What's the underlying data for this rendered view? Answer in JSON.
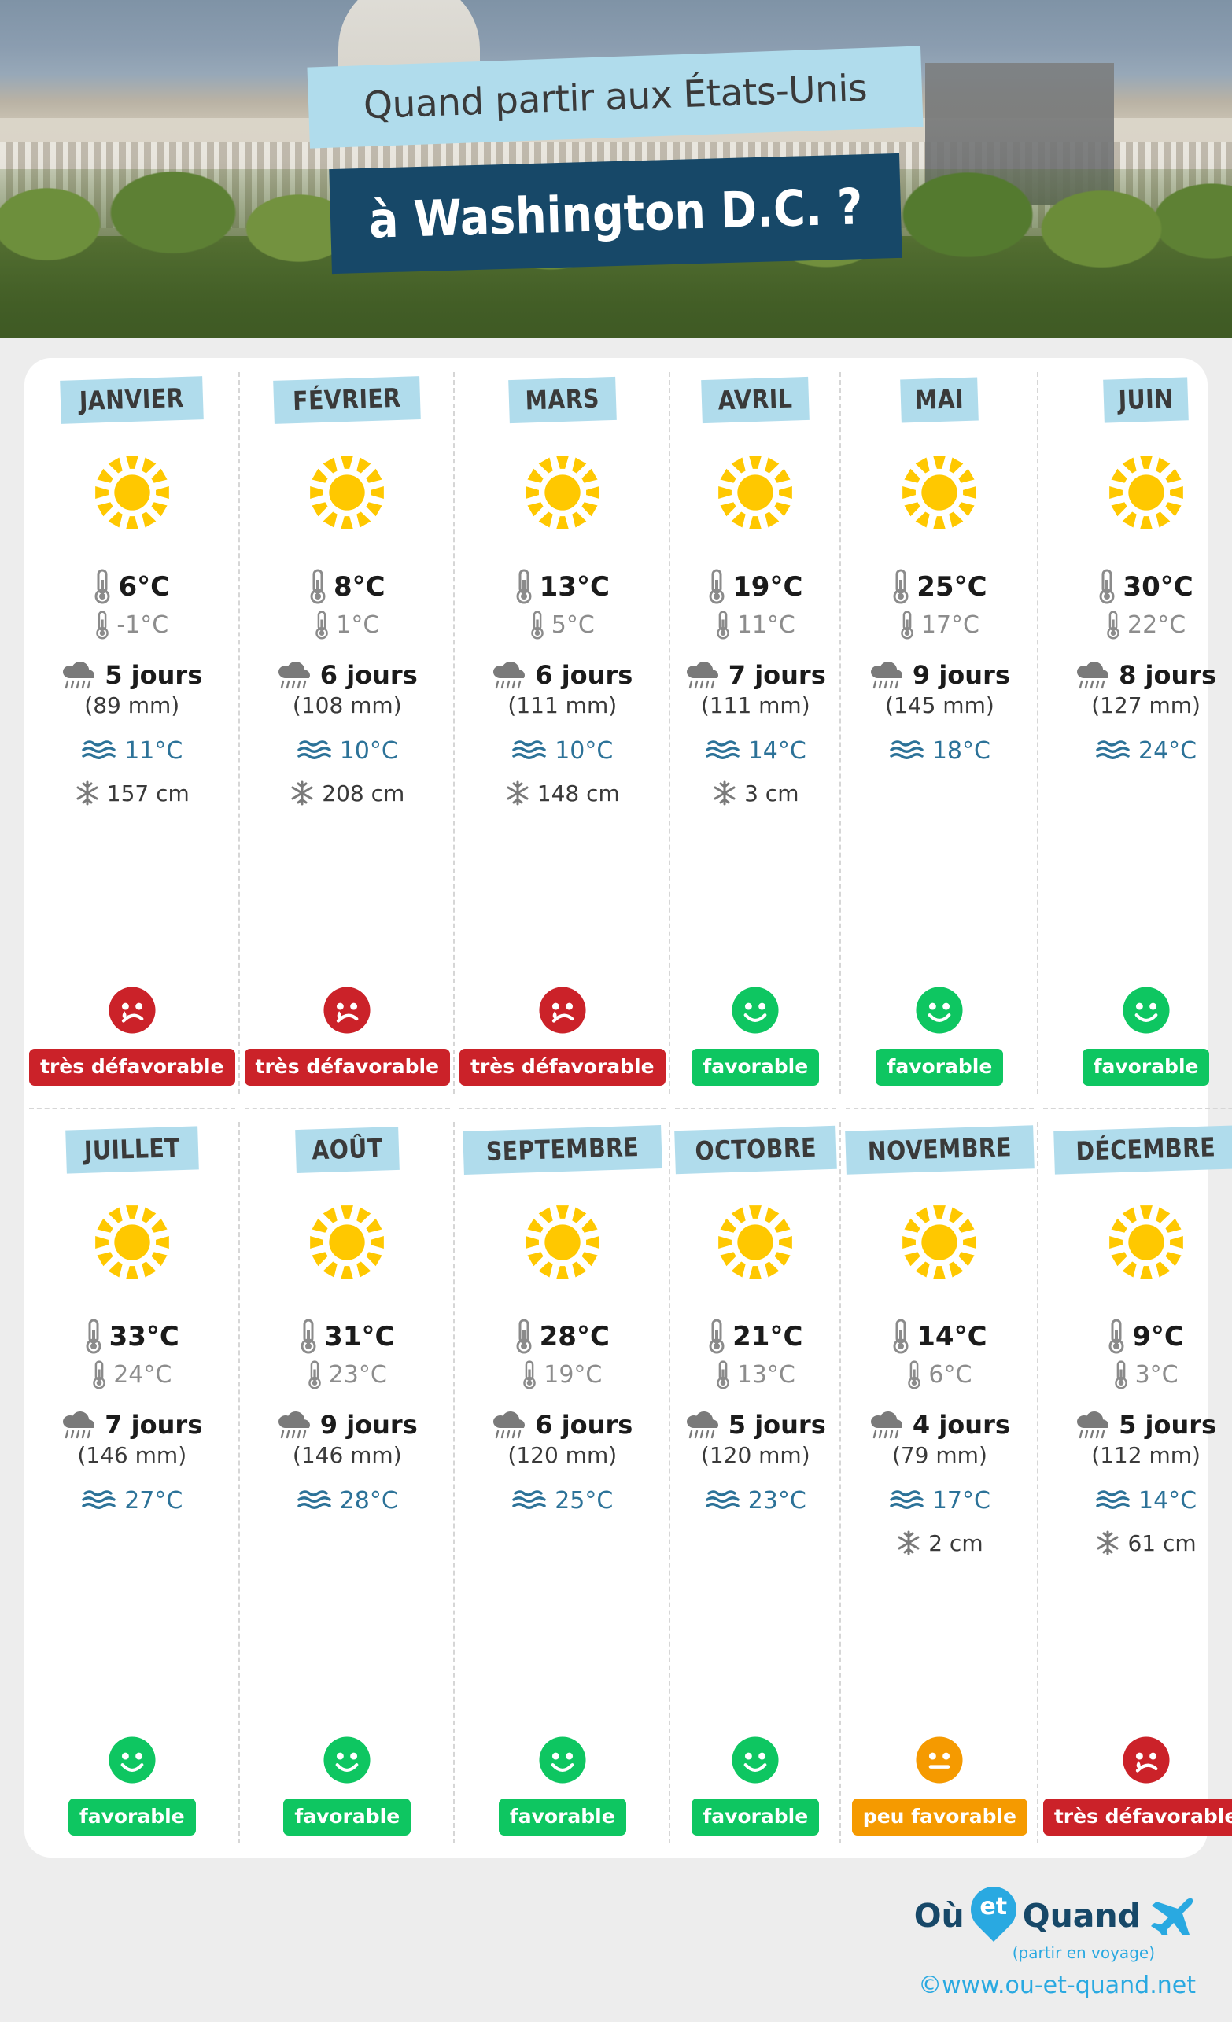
{
  "header": {
    "line1": "Quand partir aux États-Unis",
    "line2": "à Washington D.C. ?",
    "band1_color": "#b0dcec",
    "band2_color": "#174868"
  },
  "icons": {
    "sun": "sun-icon",
    "thermometer_max": "thermometer-max-icon",
    "thermometer_min": "thermometer-min-icon",
    "rain": "rain-cloud-icon",
    "sea": "sea-waves-icon",
    "snow": "snowflake-icon"
  },
  "legend": {
    "favorable": "favorable",
    "peu_favorable": "peu favorable",
    "tres_defavorable": "très défavorable"
  },
  "colors": {
    "good": "#0ec661",
    "mid": "#f59a00",
    "bad": "#cb2229",
    "sea_text": "#2c7298",
    "tmin_text": "#8d8d8d",
    "tag": "#b0dcec",
    "sun": "#ffc800",
    "brand_dark": "#174868",
    "brand_blue": "#29a9e1"
  },
  "footer": {
    "logo_ou": "Où",
    "logo_et": "et",
    "logo_quand": "Quand",
    "tagline": "(partir en voyage)",
    "url": "©www.ou-et-quand.net"
  },
  "chart_data": {
    "type": "table",
    "title": "Quand partir aux États-Unis à Washington D.C. ?",
    "columns": [
      "mois",
      "temperature_max_C",
      "temperature_min_C",
      "jours_de_pluie",
      "precipitations_mm",
      "temperature_mer_C",
      "neige_cm",
      "verdict"
    ],
    "months": [
      {
        "name": "JANVIER",
        "weather_icon": "sun",
        "tmax": "6°C",
        "tmin": "-1°C",
        "rain_days": "5 jours",
        "rain_mm": "(89 mm)",
        "sea": "11°C",
        "snow": "157 cm",
        "verdict": "très défavorable",
        "verdict_class": "bad",
        "face": "sad",
        "values": {
          "tmax": 6,
          "tmin": -1,
          "rain_days": 5,
          "rain_mm": 89,
          "sea": 11,
          "snow": 157
        }
      },
      {
        "name": "FÉVRIER",
        "weather_icon": "sun",
        "tmax": "8°C",
        "tmin": "1°C",
        "rain_days": "6 jours",
        "rain_mm": "(108 mm)",
        "sea": "10°C",
        "snow": "208 cm",
        "verdict": "très défavorable",
        "verdict_class": "bad",
        "face": "sad",
        "values": {
          "tmax": 8,
          "tmin": 1,
          "rain_days": 6,
          "rain_mm": 108,
          "sea": 10,
          "snow": 208
        }
      },
      {
        "name": "MARS",
        "weather_icon": "sun",
        "tmax": "13°C",
        "tmin": "5°C",
        "rain_days": "6 jours",
        "rain_mm": "(111 mm)",
        "sea": "10°C",
        "snow": "148 cm",
        "verdict": "très défavorable",
        "verdict_class": "bad",
        "face": "sad",
        "values": {
          "tmax": 13,
          "tmin": 5,
          "rain_days": 6,
          "rain_mm": 111,
          "sea": 10,
          "snow": 148
        }
      },
      {
        "name": "AVRIL",
        "weather_icon": "sun",
        "tmax": "19°C",
        "tmin": "11°C",
        "rain_days": "7 jours",
        "rain_mm": "(111 mm)",
        "sea": "14°C",
        "snow": "3 cm",
        "verdict": "favorable",
        "verdict_class": "good",
        "face": "happy",
        "values": {
          "tmax": 19,
          "tmin": 11,
          "rain_days": 7,
          "rain_mm": 111,
          "sea": 14,
          "snow": 3
        }
      },
      {
        "name": "MAI",
        "weather_icon": "sun",
        "tmax": "25°C",
        "tmin": "17°C",
        "rain_days": "9 jours",
        "rain_mm": "(145 mm)",
        "sea": "18°C",
        "snow": "",
        "verdict": "favorable",
        "verdict_class": "good",
        "face": "happy",
        "values": {
          "tmax": 25,
          "tmin": 17,
          "rain_days": 9,
          "rain_mm": 145,
          "sea": 18,
          "snow": null
        }
      },
      {
        "name": "JUIN",
        "weather_icon": "sun",
        "tmax": "30°C",
        "tmin": "22°C",
        "rain_days": "8 jours",
        "rain_mm": "(127 mm)",
        "sea": "24°C",
        "snow": "",
        "verdict": "favorable",
        "verdict_class": "good",
        "face": "happy",
        "values": {
          "tmax": 30,
          "tmin": 22,
          "rain_days": 8,
          "rain_mm": 127,
          "sea": 24,
          "snow": null
        }
      },
      {
        "name": "JUILLET",
        "weather_icon": "sun",
        "tmax": "33°C",
        "tmin": "24°C",
        "rain_days": "7 jours",
        "rain_mm": "(146 mm)",
        "sea": "27°C",
        "snow": "",
        "verdict": "favorable",
        "verdict_class": "good",
        "face": "happy",
        "values": {
          "tmax": 33,
          "tmin": 24,
          "rain_days": 7,
          "rain_mm": 146,
          "sea": 27,
          "snow": null
        }
      },
      {
        "name": "AOÛT",
        "weather_icon": "sun",
        "tmax": "31°C",
        "tmin": "23°C",
        "rain_days": "9 jours",
        "rain_mm": "(146 mm)",
        "sea": "28°C",
        "snow": "",
        "verdict": "favorable",
        "verdict_class": "good",
        "face": "happy",
        "values": {
          "tmax": 31,
          "tmin": 23,
          "rain_days": 9,
          "rain_mm": 146,
          "sea": 28,
          "snow": null
        }
      },
      {
        "name": "SEPTEMBRE",
        "weather_icon": "sun",
        "tmax": "28°C",
        "tmin": "19°C",
        "rain_days": "6 jours",
        "rain_mm": "(120 mm)",
        "sea": "25°C",
        "snow": "",
        "verdict": "favorable",
        "verdict_class": "good",
        "face": "happy",
        "values": {
          "tmax": 28,
          "tmin": 19,
          "rain_days": 6,
          "rain_mm": 120,
          "sea": 25,
          "snow": null
        }
      },
      {
        "name": "OCTOBRE",
        "weather_icon": "sun",
        "tmax": "21°C",
        "tmin": "13°C",
        "rain_days": "5 jours",
        "rain_mm": "(120 mm)",
        "sea": "23°C",
        "snow": "",
        "verdict": "favorable",
        "verdict_class": "good",
        "face": "happy",
        "values": {
          "tmax": 21,
          "tmin": 13,
          "rain_days": 5,
          "rain_mm": 120,
          "sea": 23,
          "snow": null
        }
      },
      {
        "name": "NOVEMBRE",
        "weather_icon": "sun",
        "tmax": "14°C",
        "tmin": "6°C",
        "rain_days": "4 jours",
        "rain_mm": "(79 mm)",
        "sea": "17°C",
        "snow": "2 cm",
        "verdict": "peu favorable",
        "verdict_class": "mid",
        "face": "neutral",
        "values": {
          "tmax": 14,
          "tmin": 6,
          "rain_days": 4,
          "rain_mm": 79,
          "sea": 17,
          "snow": 2
        }
      },
      {
        "name": "DÉCEMBRE",
        "weather_icon": "sun",
        "tmax": "9°C",
        "tmin": "3°C",
        "rain_days": "5 jours",
        "rain_mm": "(112 mm)",
        "sea": "14°C",
        "snow": "61 cm",
        "verdict": "très défavorable",
        "verdict_class": "bad",
        "face": "sad",
        "values": {
          "tmax": 9,
          "tmin": 3,
          "rain_days": 5,
          "rain_mm": 112,
          "sea": 14,
          "snow": 61
        }
      }
    ]
  }
}
